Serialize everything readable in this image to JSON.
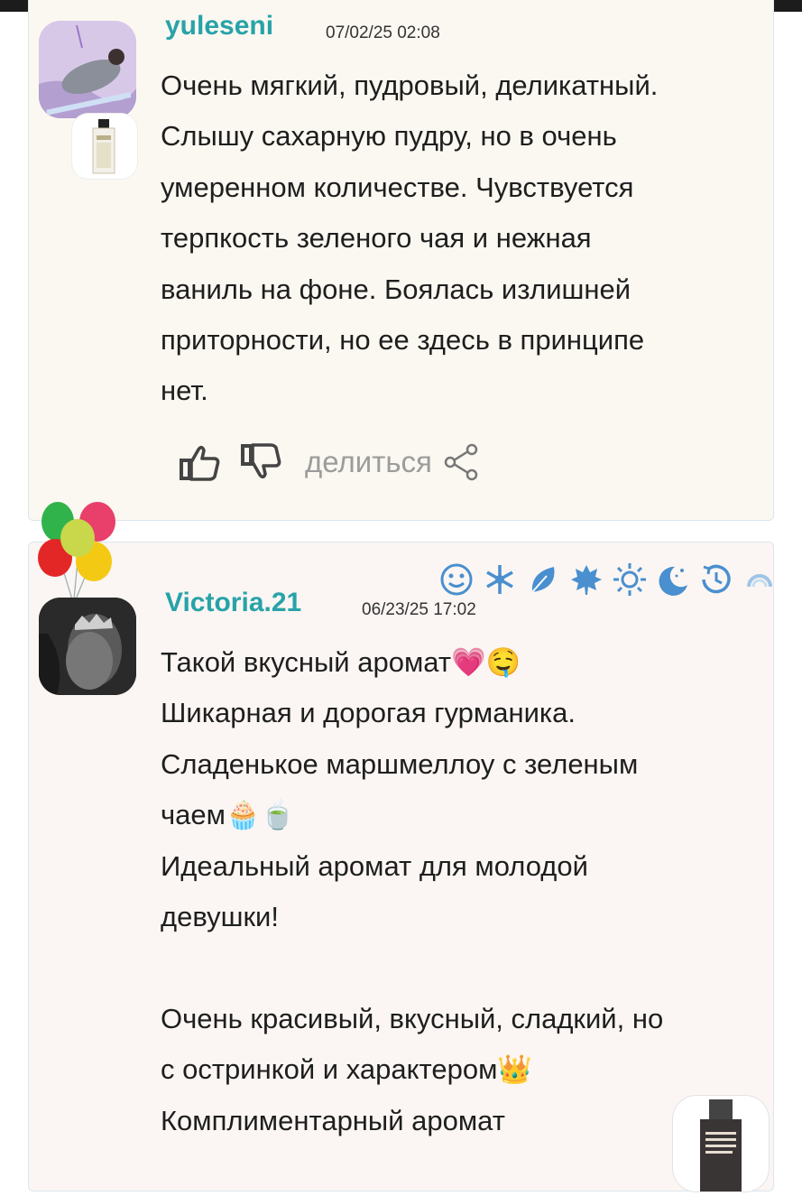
{
  "posts": [
    {
      "username": "yuleseni",
      "date": "07/02/25 02:08",
      "text": "Очень мягкий, пудровый, деликатный.\nСлышу сахарную пудру, но в очень\nумеренном количестве. Чувствуется\nтерпкость зеленого чая и нежная\nваниль на фоне. Боялась излишней\nприторности, но ее здесь в принципе\nнет.",
      "share_label": "делиться"
    },
    {
      "username": "Victoria.21",
      "date": "06/23/25 17:02",
      "text": "Такой вкусный аромат💗🤤\nШикарная и дорогая гурманика.\nСладенькое маршмеллоу с зеленым\nчаем🧁🍵\nИдеальный аромат для молодой\nдевушки!\n\nОчень красивый, вкусный, сладкий, но\nс остринкой и характером👑\nКомплиментарный аромат"
    }
  ],
  "badge_icons": [
    "smile-face-icon",
    "snowflake-icon",
    "leaf-icon",
    "maple-leaf-icon",
    "sun-icon",
    "moon-stars-icon",
    "clock-icon",
    "rainbow-icon"
  ],
  "colors": {
    "username": "#27a3a8",
    "badge": "#4a8fcf",
    "card_border": "#dbe6ee"
  }
}
